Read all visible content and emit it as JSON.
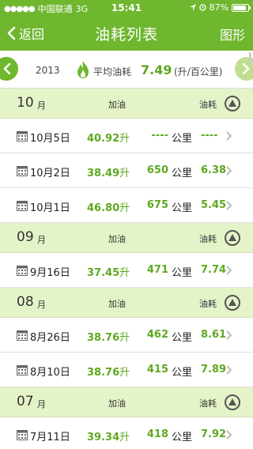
{
  "status": {
    "carrier": "中国联通",
    "network": "3G",
    "time": "15:41",
    "battery": "87%",
    "battery_level": 0.87
  },
  "nav": {
    "back_label": "返回",
    "title": "油耗列表",
    "graph_label": "图形"
  },
  "summary": {
    "year": "2013",
    "avg_label": "平均油耗",
    "avg_value": "7.49",
    "avg_unit": "(升/百公里)"
  },
  "columns": {
    "fuel": "加油",
    "consumption": "油耗"
  },
  "months": [
    {
      "month": "10",
      "unit": "月",
      "rows": [
        {
          "date": "10月5日",
          "fuel": "40.92",
          "fuel_unit": "升",
          "distance": "----",
          "distance_unit": "公里",
          "consumption": "----"
        },
        {
          "date": "10月2日",
          "fuel": "38.49",
          "fuel_unit": "升",
          "distance": "650",
          "distance_unit": "公里",
          "consumption": "6.38"
        },
        {
          "date": "10月1日",
          "fuel": "46.80",
          "fuel_unit": "升",
          "distance": "675",
          "distance_unit": "公里",
          "consumption": "5.45"
        }
      ]
    },
    {
      "month": "09",
      "unit": "月",
      "rows": [
        {
          "date": "9月16日",
          "fuel": "37.45",
          "fuel_unit": "升",
          "distance": "471",
          "distance_unit": "公里",
          "consumption": "7.74"
        }
      ]
    },
    {
      "month": "08",
      "unit": "月",
      "rows": [
        {
          "date": "8月26日",
          "fuel": "38.76",
          "fuel_unit": "升",
          "distance": "462",
          "distance_unit": "公里",
          "consumption": "8.61"
        },
        {
          "date": "8月10日",
          "fuel": "38.76",
          "fuel_unit": "升",
          "distance": "415",
          "distance_unit": "公里",
          "consumption": "7.89"
        }
      ]
    },
    {
      "month": "07",
      "unit": "月",
      "rows": [
        {
          "date": "7月11日",
          "fuel": "39.34",
          "fuel_unit": "升",
          "distance": "418",
          "distance_unit": "公里",
          "consumption": "7.92"
        }
      ]
    }
  ],
  "colors": {
    "accent": "#6fb72f",
    "value_green": "#5fa820",
    "month_header_bg": "#e4f4c8"
  }
}
